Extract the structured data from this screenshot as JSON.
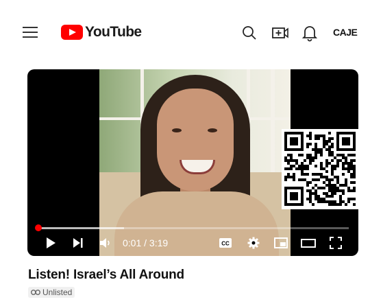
{
  "app": {
    "name": "YouTube",
    "brand_color": "#ff0000"
  },
  "header": {
    "icons": [
      "menu-icon",
      "search-icon",
      "create-video-icon",
      "notifications-bell-icon"
    ],
    "channel_logo_text": "CAJE"
  },
  "player": {
    "current_time": "0:01",
    "duration": "3:19",
    "time_display": "0:01 / 3:19",
    "progress_fraction": 0.005,
    "buffered_fraction": 0.28,
    "controls": [
      "play-icon",
      "next-icon",
      "volume-icon",
      "captions-icon",
      "settings-icon",
      "miniplayer-icon",
      "theater-mode-icon",
      "fullscreen-icon"
    ]
  },
  "video": {
    "title": "Listen! Israel’s All Around",
    "visibility": "Unlisted"
  }
}
